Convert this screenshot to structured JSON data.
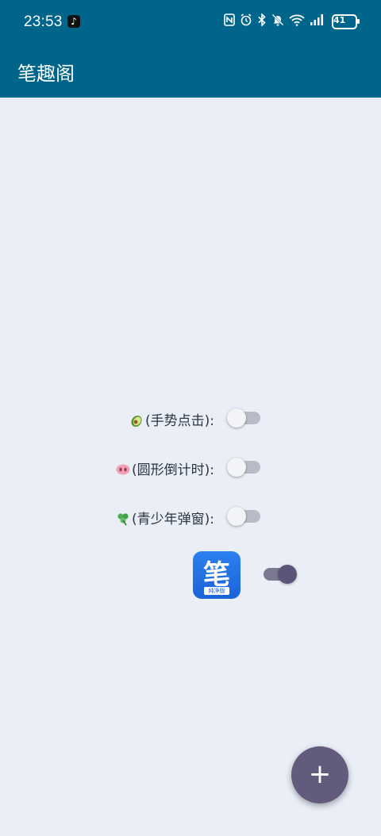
{
  "status_bar": {
    "time": "23:53",
    "tiktok_glyph": "♪",
    "nfc_icon": "N",
    "alarm_icon": "⏰",
    "bluetooth_icon": "✱",
    "mute_icon": "🔕",
    "wifi_icon": "wifi",
    "signal_icon": "signal",
    "battery": "41"
  },
  "app_bar": {
    "title": "笔趣阁"
  },
  "settings": [
    {
      "emoji_icon": "avocado-icon",
      "label": "(手势点击):",
      "enabled": false
    },
    {
      "emoji_icon": "pig-nose-icon",
      "label": "(圆形倒计时):",
      "enabled": false
    },
    {
      "emoji_icon": "clover-icon",
      "label": "(青少年弹窗):",
      "enabled": false
    }
  ],
  "app_item": {
    "logo_char": "笔",
    "logo_sub": "纯净版",
    "enabled": true
  },
  "fab": {
    "label": "+"
  },
  "colors": {
    "primary": "#00658b",
    "background": "#e9eef7",
    "accent": "#625b7c"
  }
}
